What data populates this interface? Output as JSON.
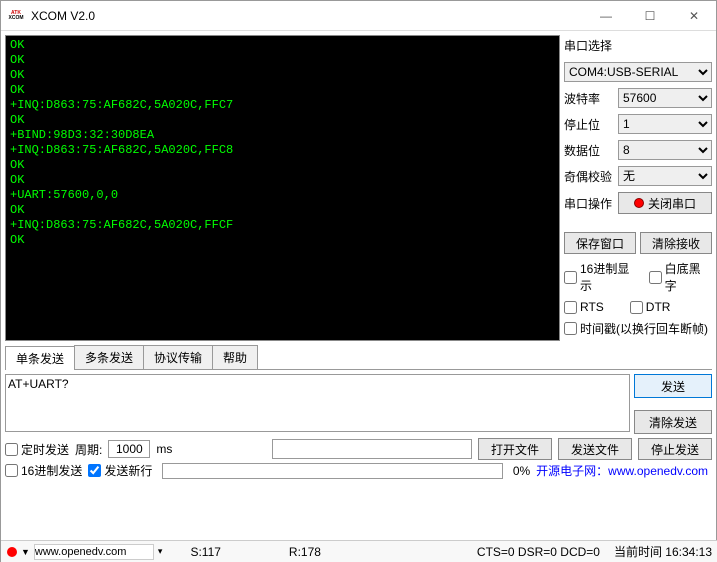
{
  "window": {
    "title": "XCOM V2.0"
  },
  "terminal": {
    "output": "OK\nOK\nOK\nOK\n+INQ:D863:75:AF682C,5A020C,FFC7\nOK\n+BIND:98D3:32:30D8EA\n+INQ:D863:75:AF682C,5A020C,FFC8\nOK\nOK\n+UART:57600,0,0\nOK\n+INQ:D863:75:AF682C,5A020C,FFCF\nOK"
  },
  "serial": {
    "select_label": "串口选择",
    "port": "COM4:USB-SERIAL",
    "baud_label": "波特率",
    "baud": "57600",
    "stop_label": "停止位",
    "stop": "1",
    "data_label": "数据位",
    "data": "8",
    "parity_label": "奇偶校验",
    "parity": "无",
    "op_label": "串口操作",
    "close_btn": "关闭串口",
    "save_window": "保存窗口",
    "clear_recv": "清除接收",
    "hex_disp": "16进制显示",
    "white_bg": "白底黑字",
    "rts": "RTS",
    "dtr": "DTR",
    "ts": "时间戳(以换行回车断帧)"
  },
  "tabs": {
    "t1": "单条发送",
    "t2": "多条发送",
    "t3": "协议传输",
    "t4": "帮助"
  },
  "send": {
    "input": "AT+UART?",
    "send_btn": "发送",
    "clear_btn": "清除发送",
    "timed": "定时发送",
    "period_lbl": "周期:",
    "period": "1000",
    "ms": "ms",
    "open_file": "打开文件",
    "send_file": "发送文件",
    "stop_send": "停止发送",
    "hex_send": "16进制发送",
    "send_newline": "发送新行",
    "progress": "0%",
    "link_text": "开源电子网：www.openedv.com"
  },
  "status": {
    "url": "www.openedv.com",
    "s": "S:117",
    "r": "R:178",
    "signals": "CTS=0 DSR=0 DCD=0",
    "time_lbl": "当前时间 16:34:13"
  }
}
